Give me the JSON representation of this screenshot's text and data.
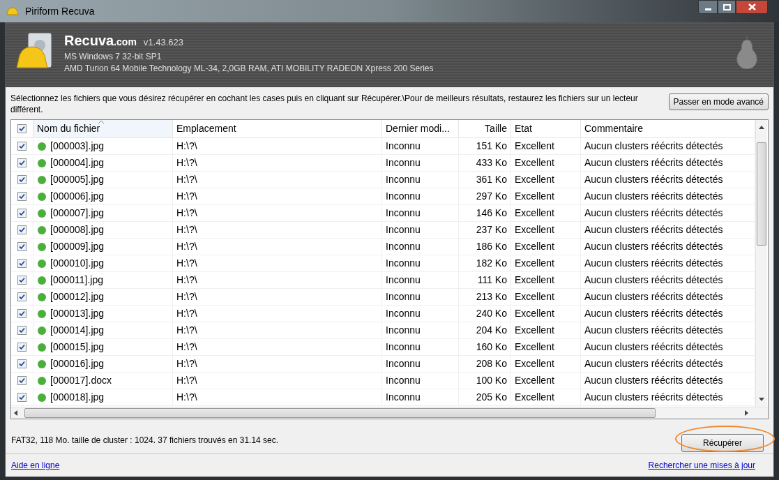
{
  "window": {
    "title": "Piriform Recuva"
  },
  "header": {
    "brand": "Recuva",
    "brand_suffix": ".com",
    "version": "v1.43.623",
    "os": "MS Windows 7 32-bit SP1",
    "hardware": "AMD Turion 64 Mobile Technology ML-34, 2,0GB RAM, ATI MOBILITY RADEON Xpress 200 Series"
  },
  "instructions": "Sélectionnez les fichiers que vous désirez récupérer en cochant les cases puis en cliquant sur Récupérer.\\Pour de meilleurs résultats, restaurez les fichiers sur un lecteur différent.",
  "advanced_button": "Passer en mode avancé",
  "table": {
    "all_checked": true,
    "columns": [
      "Nom du fichier",
      "Emplacement",
      "Dernier modi...",
      "Taille",
      "Etat",
      "Commentaire"
    ],
    "rows": [
      {
        "checked": true,
        "color": "#4caf3c",
        "name": "[000003].jpg",
        "location": "H:\\?\\",
        "modified": "Inconnu",
        "size": "151 Ko",
        "state": "Excellent",
        "comment": "Aucun clusters réécrits détectés"
      },
      {
        "checked": true,
        "color": "#4caf3c",
        "name": "[000004].jpg",
        "location": "H:\\?\\",
        "modified": "Inconnu",
        "size": "433 Ko",
        "state": "Excellent",
        "comment": "Aucun clusters réécrits détectés"
      },
      {
        "checked": true,
        "color": "#4caf3c",
        "name": "[000005].jpg",
        "location": "H:\\?\\",
        "modified": "Inconnu",
        "size": "361 Ko",
        "state": "Excellent",
        "comment": "Aucun clusters réécrits détectés"
      },
      {
        "checked": true,
        "color": "#4caf3c",
        "name": "[000006].jpg",
        "location": "H:\\?\\",
        "modified": "Inconnu",
        "size": "297 Ko",
        "state": "Excellent",
        "comment": "Aucun clusters réécrits détectés"
      },
      {
        "checked": true,
        "color": "#4caf3c",
        "name": "[000007].jpg",
        "location": "H:\\?\\",
        "modified": "Inconnu",
        "size": "146 Ko",
        "state": "Excellent",
        "comment": "Aucun clusters réécrits détectés"
      },
      {
        "checked": true,
        "color": "#4caf3c",
        "name": "[000008].jpg",
        "location": "H:\\?\\",
        "modified": "Inconnu",
        "size": "237 Ko",
        "state": "Excellent",
        "comment": "Aucun clusters réécrits détectés"
      },
      {
        "checked": true,
        "color": "#4caf3c",
        "name": "[000009].jpg",
        "location": "H:\\?\\",
        "modified": "Inconnu",
        "size": "186 Ko",
        "state": "Excellent",
        "comment": "Aucun clusters réécrits détectés"
      },
      {
        "checked": true,
        "color": "#4caf3c",
        "name": "[000010].jpg",
        "location": "H:\\?\\",
        "modified": "Inconnu",
        "size": "182 Ko",
        "state": "Excellent",
        "comment": "Aucun clusters réécrits détectés"
      },
      {
        "checked": true,
        "color": "#4caf3c",
        "name": "[000011].jpg",
        "location": "H:\\?\\",
        "modified": "Inconnu",
        "size": "111 Ko",
        "state": "Excellent",
        "comment": "Aucun clusters réécrits détectés"
      },
      {
        "checked": true,
        "color": "#4caf3c",
        "name": "[000012].jpg",
        "location": "H:\\?\\",
        "modified": "Inconnu",
        "size": "213 Ko",
        "state": "Excellent",
        "comment": "Aucun clusters réécrits détectés"
      },
      {
        "checked": true,
        "color": "#4caf3c",
        "name": "[000013].jpg",
        "location": "H:\\?\\",
        "modified": "Inconnu",
        "size": "240 Ko",
        "state": "Excellent",
        "comment": "Aucun clusters réécrits détectés"
      },
      {
        "checked": true,
        "color": "#4caf3c",
        "name": "[000014].jpg",
        "location": "H:\\?\\",
        "modified": "Inconnu",
        "size": "204 Ko",
        "state": "Excellent",
        "comment": "Aucun clusters réécrits détectés"
      },
      {
        "checked": true,
        "color": "#4caf3c",
        "name": "[000015].jpg",
        "location": "H:\\?\\",
        "modified": "Inconnu",
        "size": "160 Ko",
        "state": "Excellent",
        "comment": "Aucun clusters réécrits détectés"
      },
      {
        "checked": true,
        "color": "#4caf3c",
        "name": "[000016].jpg",
        "location": "H:\\?\\",
        "modified": "Inconnu",
        "size": "208 Ko",
        "state": "Excellent",
        "comment": "Aucun clusters réécrits détectés"
      },
      {
        "checked": true,
        "color": "#4caf3c",
        "name": "[000017].docx",
        "location": "H:\\?\\",
        "modified": "Inconnu",
        "size": "100 Ko",
        "state": "Excellent",
        "comment": "Aucun clusters réécrits détectés"
      },
      {
        "checked": true,
        "color": "#4caf3c",
        "name": "[000018].jpg",
        "location": "H:\\?\\",
        "modified": "Inconnu",
        "size": "205 Ko",
        "state": "Excellent",
        "comment": "Aucun clusters réécrits détectés"
      }
    ]
  },
  "status": "FAT32, 118 Mo. taille de cluster : 1024. 37 fichiers trouvés en 31.14 sec.",
  "recover_button": "Récupérer",
  "footer": {
    "help_link": "Aide en ligne",
    "update_link": "Rechercher une mises à jour"
  }
}
